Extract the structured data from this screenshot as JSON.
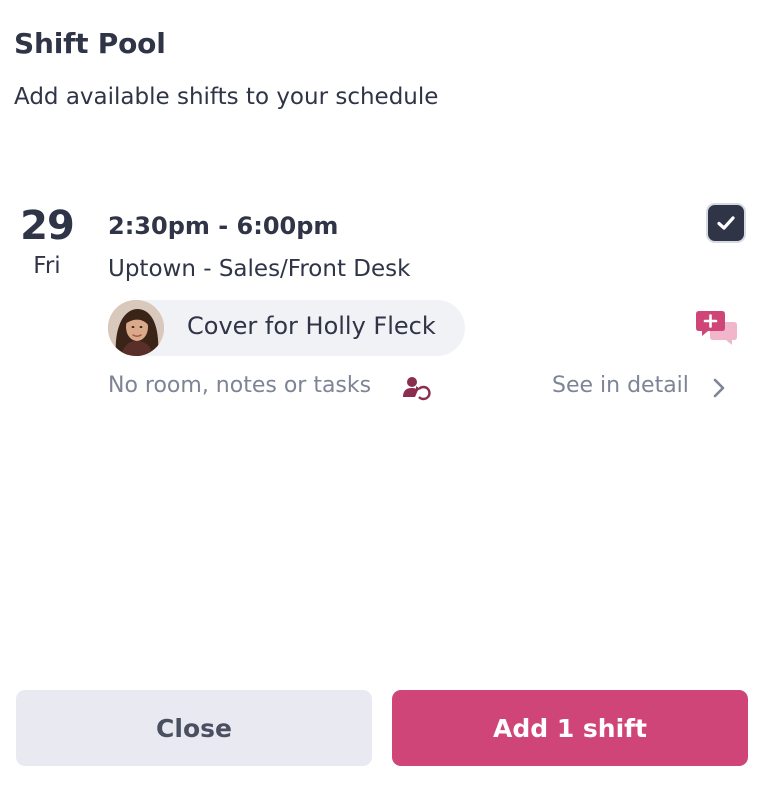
{
  "header": {
    "title": "Shift Pool",
    "subtitle": "Add available shifts to your schedule"
  },
  "shift": {
    "date_number": "29",
    "date_weekday": "Fri",
    "time_range": "2:30pm - 6:00pm",
    "location": "Uptown - Sales/Front Desk",
    "cover_label": "Cover for Holly Fleck",
    "notes_text": "No room, notes or tasks",
    "see_detail_label": "See in detail",
    "selected": true
  },
  "footer": {
    "close_label": "Close",
    "add_label": "Add 1 shift"
  },
  "icons": {
    "checkbox": "checkmark-icon",
    "chat": "chat-bubbles-icon",
    "notes": "users-refresh-icon",
    "chevron": "chevron-right-icon"
  },
  "colors": {
    "primary_text": "#2f3447",
    "muted_text": "#7d8496",
    "accent": "#d04577",
    "secondary_button": "#e9eaf1",
    "pill_bg": "#f1f2f6"
  }
}
